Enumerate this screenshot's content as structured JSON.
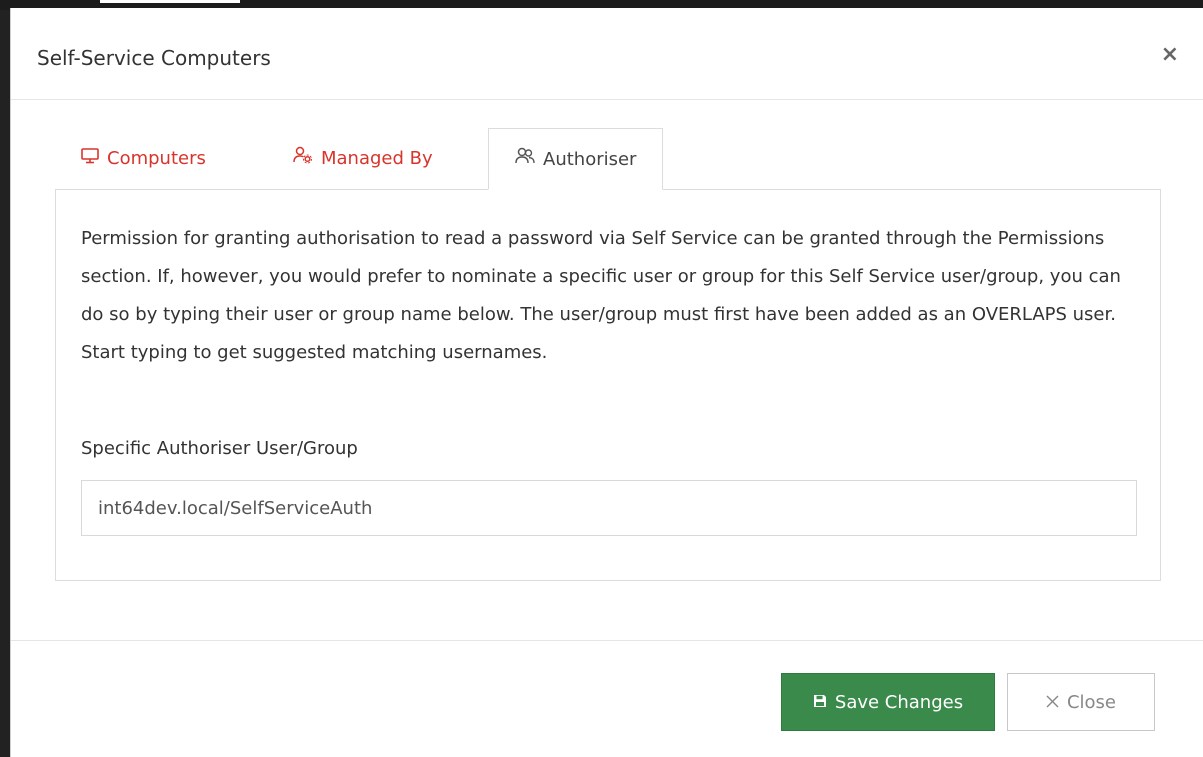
{
  "modal": {
    "title": "Self-Service Computers",
    "close_glyph": "×"
  },
  "tabs": [
    {
      "label": "Computers",
      "icon": "monitor-icon",
      "active": false
    },
    {
      "label": "Managed By",
      "icon": "user-gear-icon",
      "active": false
    },
    {
      "label": "Authoriser",
      "icon": "users-icon",
      "active": true
    }
  ],
  "authoriser": {
    "description": "Permission for granting authorisation to read a password via Self Service can be granted through the Permissions section. If, however, you would prefer to nominate a specific user or group for this Self Service user/group, you can do so by typing their user or group name below. The user/group must first have been added as an OVERLAPS user. Start typing to get suggested matching usernames.",
    "field_label": "Specific Authoriser User/Group",
    "field_value": "int64dev.local/SelfServiceAuth"
  },
  "footer": {
    "save_label": "Save Changes",
    "close_label": "Close"
  },
  "colors": {
    "tab_link": "#d9342b",
    "save_button": "#3a8a4b"
  }
}
